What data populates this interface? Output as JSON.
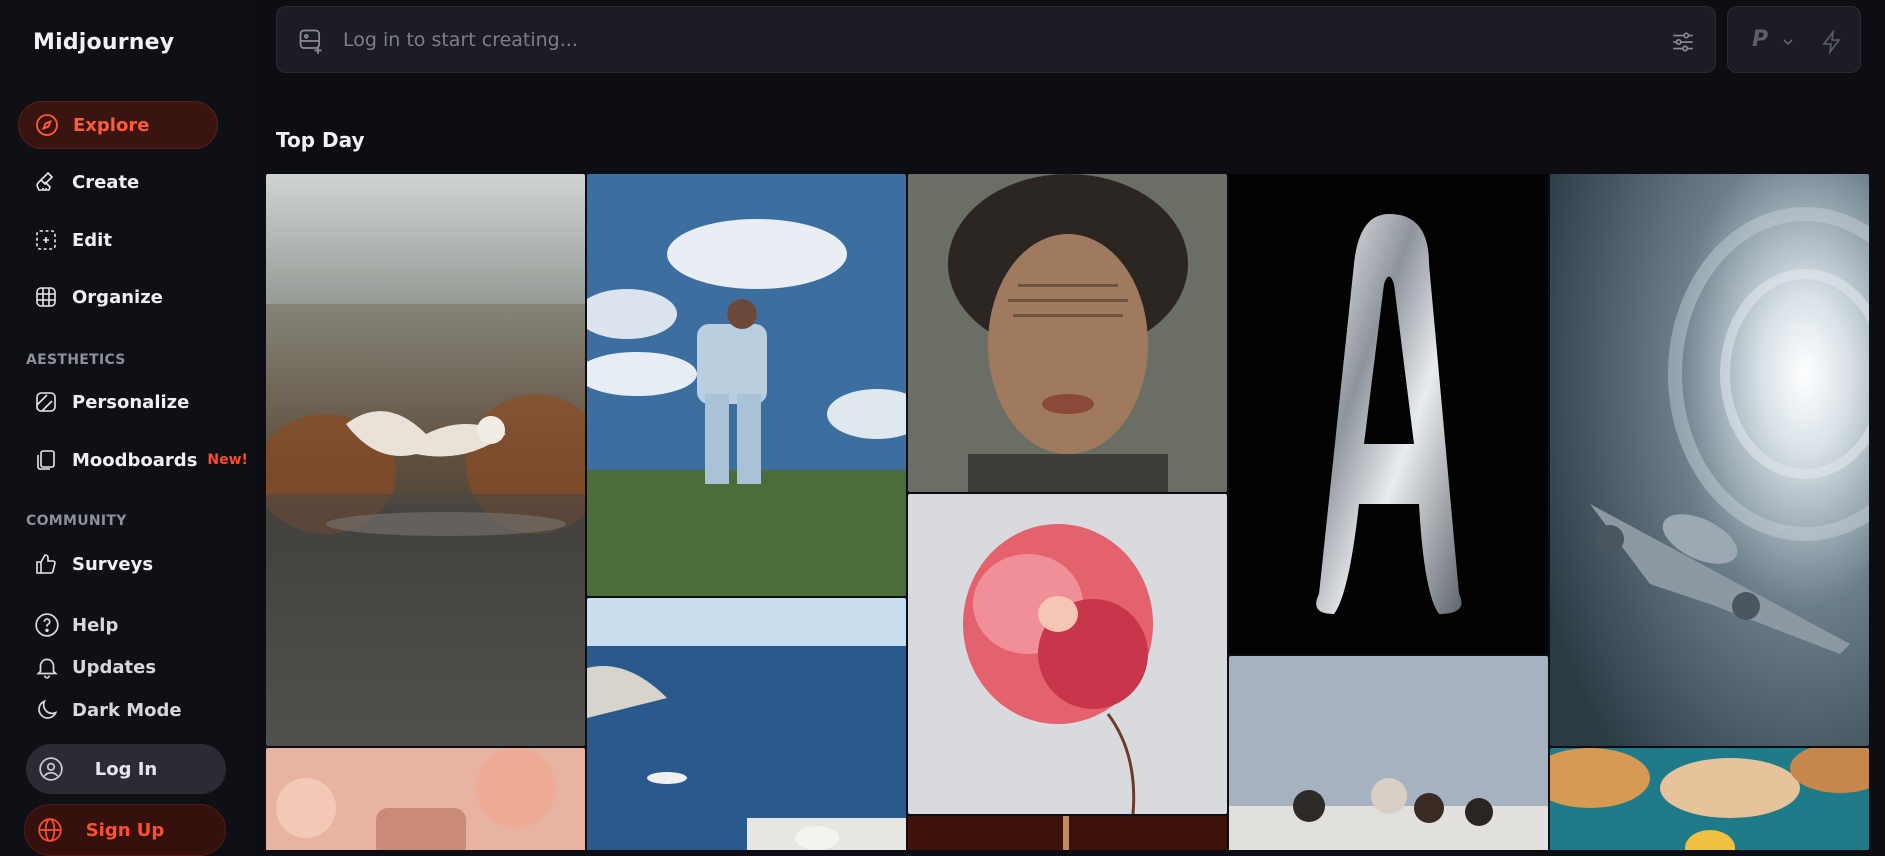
{
  "app": {
    "title": "Midjourney"
  },
  "nav": {
    "explore": "Explore",
    "create": "Create",
    "edit": "Edit",
    "organize": "Organize"
  },
  "sections": {
    "aesthetics": "AESTHETICS",
    "community": "COMMUNITY"
  },
  "aesthetics": {
    "personalize": "Personalize",
    "moodboards": "Moodboards",
    "moodboards_badge": "New!"
  },
  "community": {
    "surveys": "Surveys"
  },
  "utility": {
    "help": "Help",
    "updates": "Updates",
    "dark_mode": "Dark Mode"
  },
  "auth": {
    "login": "Log In",
    "signup": "Sign Up"
  },
  "prompt": {
    "placeholder": "Log in to start creating..."
  },
  "mode": {
    "letter": "P"
  },
  "gallery": {
    "title": "Top Day"
  },
  "colors": {
    "accent": "#ff4a2a",
    "background": "#0d0e14",
    "sidebar": "#0f1016"
  }
}
